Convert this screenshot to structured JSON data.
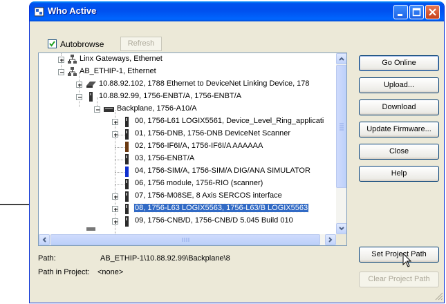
{
  "window": {
    "title": "Who Active"
  },
  "toolbar": {
    "autobrowse_label": "Autobrowse",
    "autobrowse_checked": true,
    "refresh_label": "Refresh"
  },
  "tree": {
    "nodes": [
      {
        "label": "Linx Gateways, Ethernet",
        "icon": "network-icon",
        "expander": "plus"
      },
      {
        "label": "AB_ETHIP-1, Ethernet",
        "icon": "network-icon",
        "expander": "minus"
      },
      {
        "label": "10.88.92.102, 1788 Ethernet to DeviceNet Linking Device, 178",
        "icon": "device-icon",
        "expander": "plus"
      },
      {
        "label": "10.88.92.99, 1756-ENBT/A, 1756-ENBT/A",
        "icon": "module-icon",
        "expander": "minus"
      },
      {
        "label": "Backplane, 1756-A10/A",
        "icon": "backplane-icon",
        "expander": "minus"
      },
      {
        "label": "00, 1756-L61 LOGIX5561, Device_Level_Ring_applicati",
        "icon": "module-icon",
        "expander": "plus"
      },
      {
        "label": "01, 1756-DNB, 1756-DNB DeviceNet Scanner",
        "icon": "module-icon",
        "expander": "plus"
      },
      {
        "label": "02, 1756-IF6I/A, 1756-IF6I/A AAAAAA",
        "icon": "module-icon",
        "expander": "none"
      },
      {
        "label": "03, 1756-ENBT/A",
        "icon": "module-icon",
        "expander": "none"
      },
      {
        "label": "04, 1756-SIM/A, 1756-SIM/A DIG/ANA SIMULATOR",
        "icon": "module-icon",
        "expander": "none"
      },
      {
        "label": "06, 1756 module, 1756-RIO (scanner)",
        "icon": "module-icon",
        "expander": "none"
      },
      {
        "label": "07, 1756-M08SE, 8 Axis SERCOS interface",
        "icon": "module-icon",
        "expander": "plus"
      },
      {
        "label": "08, 1756-L63 LOGIX5563, 1756-L63/B LOGIX5563",
        "icon": "module-icon",
        "expander": "plus",
        "selected": true
      },
      {
        "label": "09, 1756-CNB/D, 1756-CNB/D 5.045 Build 010",
        "icon": "module-icon",
        "expander": "plus"
      }
    ]
  },
  "buttons": {
    "go_online": "Go Online",
    "upload": "Upload...",
    "download": "Download",
    "update_firmware": "Update Firmware...",
    "close": "Close",
    "help": "Help",
    "set_project_path": "Set Project Path",
    "clear_project_path": "Clear Project Path"
  },
  "path": {
    "path_label": "Path:",
    "path_value": "AB_ETHIP-1\\10.88.92.99\\Backplane\\8",
    "project_label": "Path in Project:",
    "project_value": "<none>"
  },
  "colors": {
    "title_bar": "#0054e3",
    "selection": "#316ac5",
    "window_bg": "#ece9d8"
  }
}
